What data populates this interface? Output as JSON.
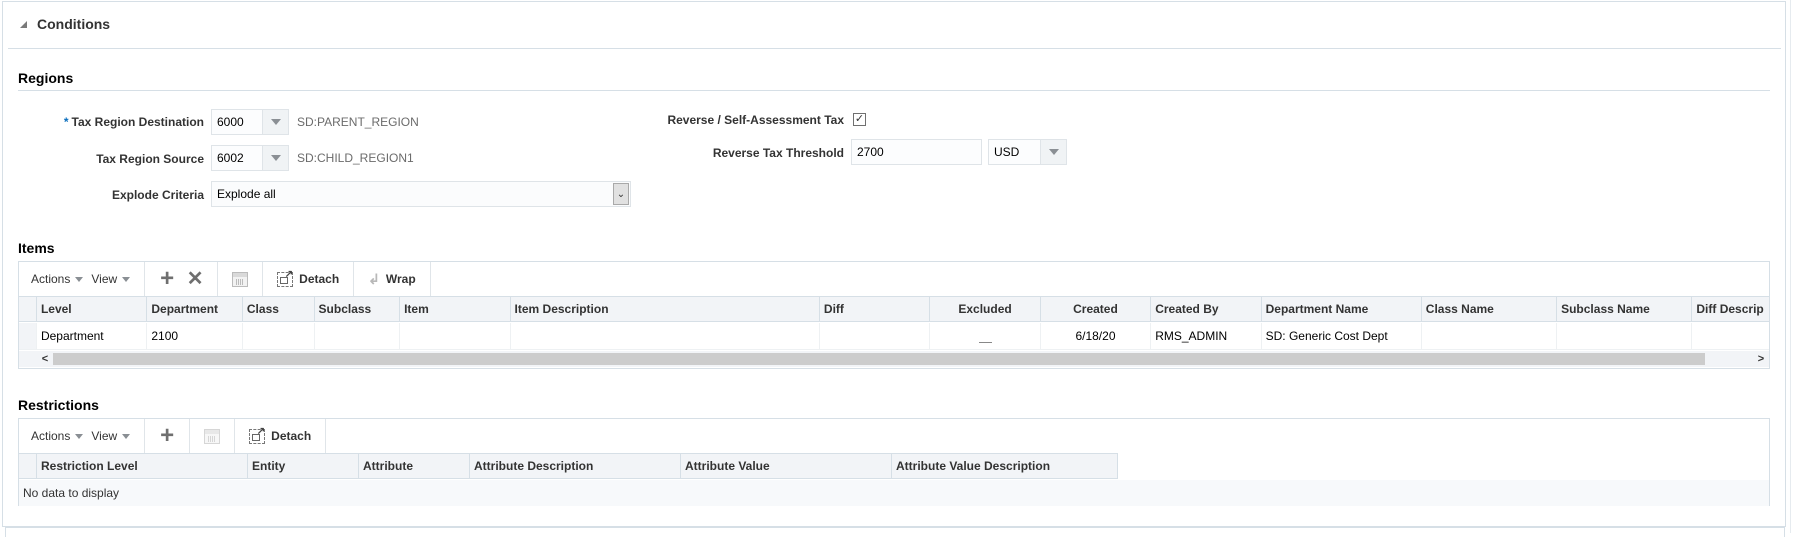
{
  "conditions": {
    "title": "Conditions",
    "disclosure_icon": "collapse-triangle-icon"
  },
  "regions": {
    "title": "Regions",
    "tax_region_destination": {
      "label": "Tax Region Destination",
      "required_marker": "*",
      "value": "6000",
      "description": "SD:PARENT_REGION"
    },
    "tax_region_source": {
      "label": "Tax Region Source",
      "value": "6002",
      "description": "SD:CHILD_REGION1"
    },
    "explode_criteria": {
      "label": "Explode Criteria",
      "value": "Explode all"
    },
    "reverse_tax": {
      "label": "Reverse / Self-Assessment Tax",
      "checked": true,
      "check_glyph": "✓"
    },
    "reverse_tax_threshold": {
      "label": "Reverse Tax Threshold",
      "value": "2700",
      "currency": "USD"
    }
  },
  "items": {
    "title": "Items",
    "toolbar": {
      "actions_label": "Actions",
      "view_label": "View",
      "add_glyph": "+",
      "delete_glyph": "✕",
      "detach_label": "Detach",
      "wrap_label": "Wrap",
      "wrap_glyph": "↲",
      "scroll_left": "<",
      "scroll_right": ">"
    },
    "columns": [
      "Level",
      "Department",
      "Class",
      "Subclass",
      "Item",
      "Item Description",
      "Diff",
      "Excluded",
      "Created",
      "Created By",
      "Department Name",
      "Class Name",
      "Subclass Name",
      "Diff Descrip"
    ],
    "rows": [
      {
        "level": "Department",
        "department": "2100",
        "class": "",
        "subclass": "",
        "item": "",
        "item_description": "",
        "diff": "",
        "excluded": false,
        "created": "6/18/20",
        "created_by": "RMS_ADMIN",
        "department_name": "SD: Generic Cost Dept",
        "class_name": "",
        "subclass_name": "",
        "diff_description": ""
      }
    ]
  },
  "restrictions": {
    "title": "Restrictions",
    "toolbar": {
      "actions_label": "Actions",
      "view_label": "View",
      "add_glyph": "+",
      "detach_label": "Detach"
    },
    "columns": [
      "Restriction Level",
      "Entity",
      "Attribute",
      "Attribute Description",
      "Attribute Value",
      "Attribute Value Description"
    ],
    "empty_message": "No data to display"
  }
}
